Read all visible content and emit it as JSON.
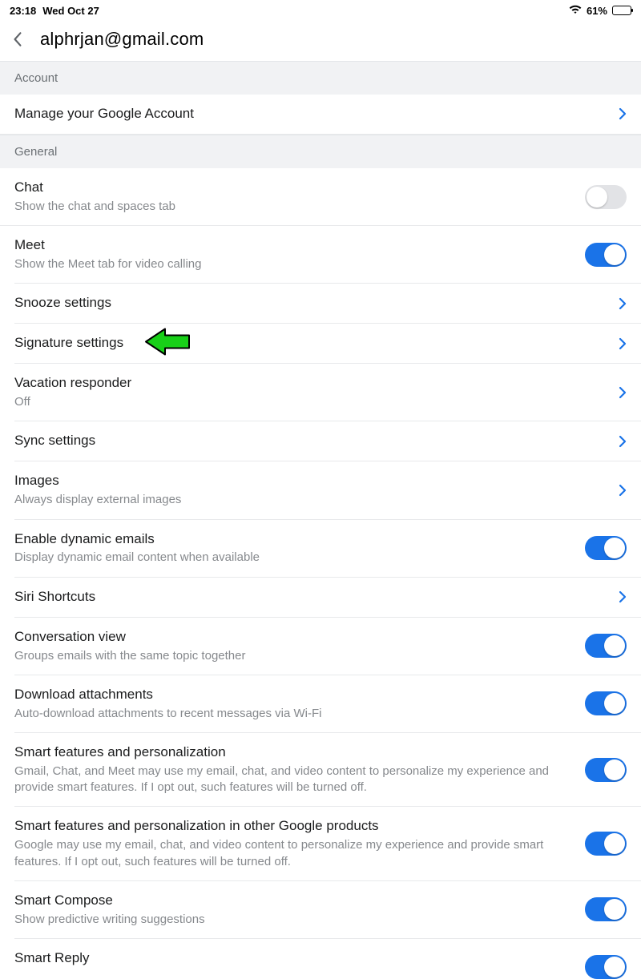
{
  "status": {
    "time": "23:18",
    "date": "Wed Oct 27",
    "battery_percent": "61%"
  },
  "header": {
    "title": "alphrjan@gmail.com"
  },
  "sections": {
    "account": {
      "label": "Account"
    },
    "general": {
      "label": "General"
    }
  },
  "rows": {
    "manage": {
      "title": "Manage your Google Account"
    },
    "chat": {
      "title": "Chat",
      "sub": "Show the chat and spaces tab"
    },
    "meet": {
      "title": "Meet",
      "sub": "Show the Meet tab for video calling"
    },
    "snooze": {
      "title": "Snooze settings"
    },
    "signature": {
      "title": "Signature settings"
    },
    "vacation": {
      "title": "Vacation responder",
      "sub": "Off"
    },
    "sync": {
      "title": "Sync settings"
    },
    "images": {
      "title": "Images",
      "sub": "Always display external images"
    },
    "dynamic": {
      "title": "Enable dynamic emails",
      "sub": "Display dynamic email content when available"
    },
    "siri": {
      "title": "Siri Shortcuts"
    },
    "conversation": {
      "title": "Conversation view",
      "sub": "Groups emails with the same topic together"
    },
    "download": {
      "title": "Download attachments",
      "sub": "Auto-download attachments to recent messages via Wi-Fi"
    },
    "smart1": {
      "title": "Smart features and personalization",
      "sub": "Gmail, Chat, and Meet may use my email, chat, and video content to personalize my experience and provide smart features. If I opt out, such features will be turned off."
    },
    "smart2": {
      "title": "Smart features and personalization in other Google products",
      "sub": "Google may use my email, chat, and video content to personalize my experience and provide smart features. If I opt out, such features will be turned off."
    },
    "compose": {
      "title": "Smart Compose",
      "sub": "Show predictive writing suggestions"
    },
    "reply": {
      "title": "Smart Reply"
    }
  }
}
